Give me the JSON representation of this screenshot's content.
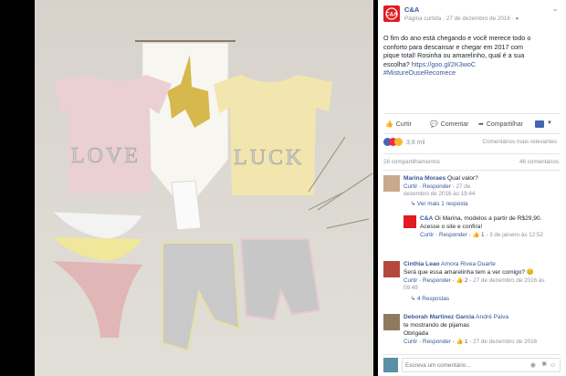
{
  "post": {
    "page_name": "C&A",
    "page_type": "Página curtida",
    "date": "27 de dezembro de 2016",
    "text_lines": [
      "O fim do ano está chegando e você merece todo o",
      "conforto para descansar e chegar em 2017 com",
      "pique total! Rosinha ou amarelinho, qual é a sua",
      "escolha?"
    ],
    "link": "https://goo.gl/2K3woC",
    "hashtag": "#MistureOuseRecomece",
    "photo_words": [
      "LOVE",
      "LUCK"
    ]
  },
  "actions": {
    "like": "Curtir",
    "comment": "Comentar",
    "share": "Compartilhar"
  },
  "stats": {
    "reactions": "3,8 mil",
    "relevance": "Comentários mais relevantes",
    "shares": "28 compartilhamentos",
    "comments_count": "46 comentários"
  },
  "comments": [
    {
      "author": "Marina Moraes",
      "text": "Qual valor?",
      "meta_like": "Curtir",
      "meta_reply": "Responder",
      "meta_time": "27 de dezembro de 2016 às 19:44",
      "replies_link": "Ver mais 1 resposta"
    },
    {
      "author": "C&A",
      "text": "Oi Marina, modelos a partir de R$29,90. Acesse o site e confira!",
      "meta_like": "Curtir",
      "meta_reply": "Responder",
      "meta_count": "1",
      "meta_time": "3 de janeiro às 12:52"
    },
    {
      "author": "Cinthia Leao",
      "mention": "Amora Rivea Duarte",
      "text": "Será que essa amarelinha tem a ver comigo?",
      "meta_like": "Curtir",
      "meta_reply": "Responder",
      "meta_count": "2",
      "meta_time": "27 de dezembro de 2016 às 09:49",
      "replies_link": "4 Respostas"
    },
    {
      "author": "Deborah Martinez Garcia",
      "mention": "André Paiva",
      "text": "te mostrando de pijamas",
      "text2": "Obrigada",
      "meta_like": "Curtir",
      "meta_reply": "Responder",
      "meta_count": "1",
      "meta_time": "27 de dezembro de 2016"
    }
  ],
  "composer": {
    "placeholder": "Escreva um comentário..."
  }
}
